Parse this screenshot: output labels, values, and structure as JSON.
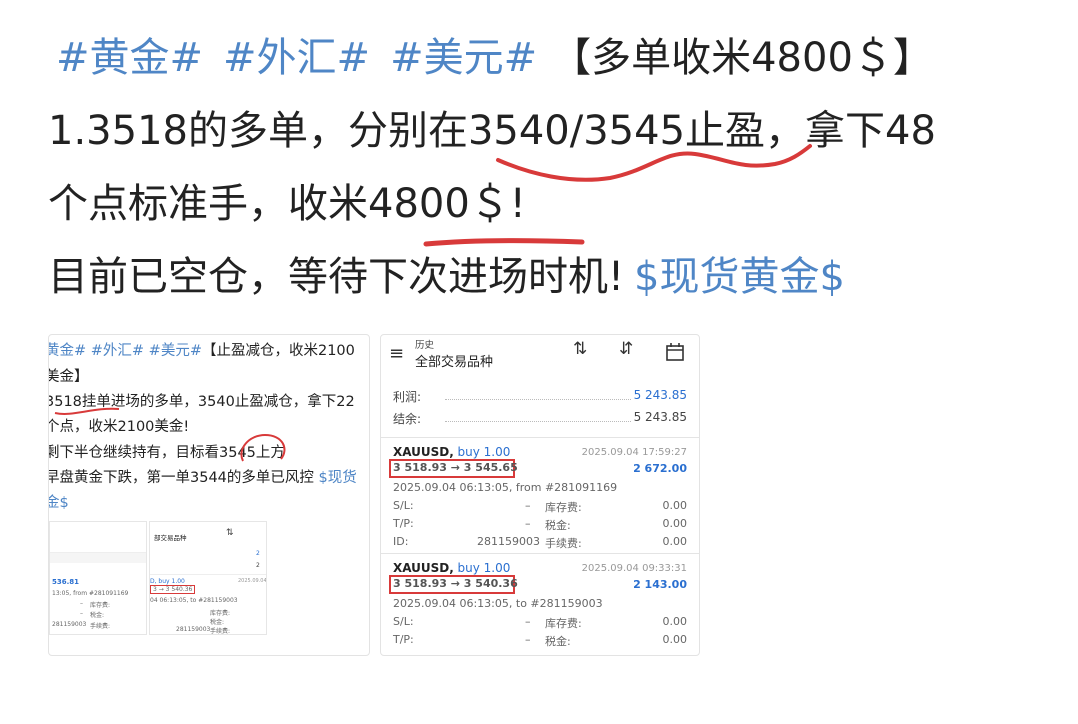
{
  "post": {
    "line1": {
      "tag1": "#黄金#",
      "tag2": "#外汇#",
      "tag3": "#美元#",
      "bracket": "【多单收米4800＄】"
    },
    "line2": "1.3518的多单，分别在3540/3545止盈，拿下48",
    "line3": "个点标准手，收米4800＄!",
    "line4": {
      "text": "目前已空仓，等待下次进场时机!",
      "tag": "$现货黄金$"
    }
  },
  "thumb1": {
    "l1_tags": "黄金#  #外汇#  #美元#",
    "l1_rest": "【止盈减仓，收米2100",
    "l2": "美金】",
    "l3": "3518挂单进场的多单，3540止盈减仓，拿下22",
    "l4": "个点，收米2100美金!",
    "l5": "剩下半仓继续持有，目标看3545上方",
    "l6_text": "早盘黄金下跌，第一单3544的多单已风控 ",
    "l6_tag": "$现货",
    "l7_tag": "金$",
    "mini_left": {
      "profit": "536.81",
      "from": "13:05, from #281091169",
      "n1": "库存费:",
      "n2": "税金:",
      "id": "281159003",
      "fee": "手续费:",
      "dash1": "–",
      "dash2": "–"
    },
    "mini_right": {
      "title": "部交易品种",
      "v1": "2",
      "v2": "2",
      "sym": "D, buy 1.00",
      "date": "2025.09.04",
      "price": "3 → 3 540.36",
      "from": "04 06:13:05, to #281159003",
      "n1": "库存费:",
      "n2": "税金:",
      "id": "281159003",
      "fee": "手续费:"
    }
  },
  "thumb2": {
    "header": {
      "sub": "历史",
      "title": "全部交易品种"
    },
    "summary": {
      "profit_label": "利润:",
      "profit_value": "5 243.85",
      "balance_label": "结余:",
      "balance_value": "5 243.85"
    },
    "trades": [
      {
        "symbol": "XAUUSD,",
        "side": "buy 1.00",
        "time": "2025.09.04 17:59:27",
        "price": "3 518.93 → 3 545.65",
        "profit": "2 672.00",
        "open": "2025.09.04 06:13:05, from #281091169",
        "sl_label": "S/L:",
        "sl": "–",
        "tp_label": "T/P:",
        "tp": "–",
        "id_label": "ID:",
        "id": "281159003",
        "swap_label": "库存费:",
        "swap": "0.00",
        "tax_label": "税金:",
        "tax": "0.00",
        "fee_label": "手续费:",
        "fee": "0.00"
      },
      {
        "symbol": "XAUUSD,",
        "side": "buy 1.00",
        "time": "2025.09.04 09:33:31",
        "price": "3 518.93 → 3 540.36",
        "profit": "2 143.00",
        "open": "2025.09.04 06:13:05, to #281159003",
        "sl_label": "S/L:",
        "sl": "–",
        "tp_label": "T/P:",
        "tp": "–",
        "swap_label": "库存费:",
        "swap": "0.00",
        "tax_label": "税金:",
        "tax": "0.00"
      }
    ]
  },
  "colors": {
    "tag": "#4f86c6",
    "annotation": "#d83a3a",
    "profit": "#2a6fd0"
  }
}
